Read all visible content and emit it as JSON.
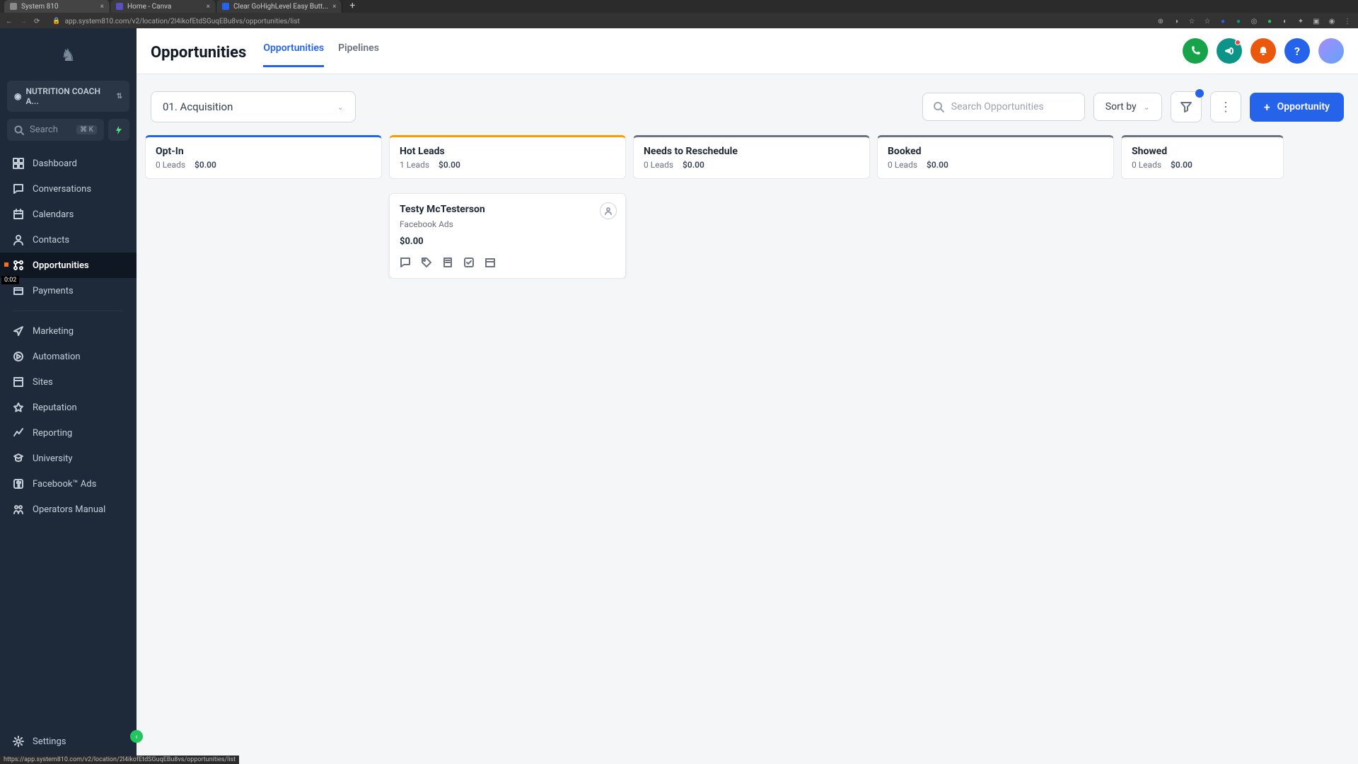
{
  "browser": {
    "tabs": [
      {
        "title": "System 810",
        "active": true
      },
      {
        "title": "Home - Canva",
        "active": false
      },
      {
        "title": "Clear GoHighLevel Easy Butt...",
        "active": false
      }
    ],
    "url": "app.system810.com/v2/location/2l4ikofEtdSGuqEBu8vs/opportunities/list",
    "status_url": "https://app.system810.com/v2/location/2l4ikofEtdSGuqEBu8vs/opportunities/list"
  },
  "sidebar": {
    "location": "NUTRITION COACH A...",
    "search_placeholder": "Search",
    "search_kbd": "⌘ K",
    "items": [
      {
        "label": "Dashboard"
      },
      {
        "label": "Conversations"
      },
      {
        "label": "Calendars"
      },
      {
        "label": "Contacts"
      },
      {
        "label": "Opportunities"
      },
      {
        "label": "Payments"
      }
    ],
    "items2": [
      {
        "label": "Marketing"
      },
      {
        "label": "Automation"
      },
      {
        "label": "Sites"
      },
      {
        "label": "Reputation"
      },
      {
        "label": "Reporting"
      },
      {
        "label": "University"
      },
      {
        "label": "Facebook™ Ads"
      },
      {
        "label": "Operators Manual"
      }
    ],
    "settings": "Settings"
  },
  "header": {
    "title": "Opportunities",
    "tabs": [
      {
        "label": "Opportunities",
        "active": true
      },
      {
        "label": "Pipelines",
        "active": false
      }
    ]
  },
  "toolbar": {
    "pipeline": "01. Acquisition",
    "search_placeholder": "Search Opportunities",
    "sort_label": "Sort by",
    "add_label": "Opportunity"
  },
  "columns": [
    {
      "title": "Opt-In",
      "leads": "0 Leads",
      "amount": "$0.00",
      "cards": []
    },
    {
      "title": "Hot Leads",
      "leads": "1 Leads",
      "amount": "$0.00",
      "cards": [
        {
          "name": "Testy McTesterson",
          "source": "Facebook Ads",
          "value": "$0.00"
        }
      ]
    },
    {
      "title": "Needs to Reschedule",
      "leads": "0 Leads",
      "amount": "$0.00",
      "cards": []
    },
    {
      "title": "Booked",
      "leads": "0 Leads",
      "amount": "$0.00",
      "cards": []
    },
    {
      "title": "Showed",
      "leads": "0 Leads",
      "amount": "$0.00",
      "cards": []
    }
  ],
  "timestamp": "0:02"
}
